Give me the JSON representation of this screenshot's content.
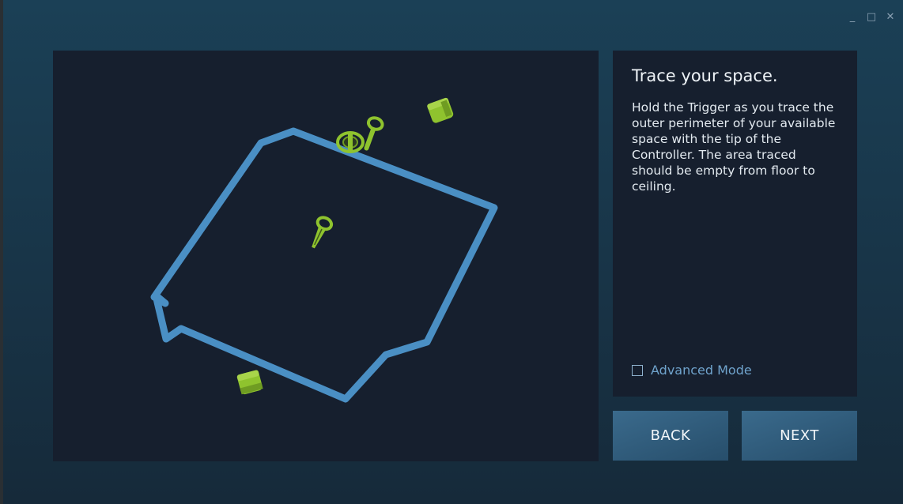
{
  "window": {
    "controls": [
      {
        "name": "minimize-button",
        "glyph": "_"
      },
      {
        "name": "maximize-button",
        "glyph": "□"
      },
      {
        "name": "close-button",
        "glyph": "✕"
      }
    ]
  },
  "panel": {
    "title": "Trace your space.",
    "body": "Hold the Trigger as you trace the outer perimeter of your available space with the tip of the Controller. The area traced should be empty from floor to ceiling.",
    "advanced_mode": {
      "label": "Advanced Mode",
      "checked": false
    }
  },
  "buttons": {
    "back": "BACK",
    "next": "NEXT"
  },
  "colors": {
    "trace": "#4a8fc4",
    "device": "#8fc32e",
    "accent_text": "#6fa3cc"
  }
}
